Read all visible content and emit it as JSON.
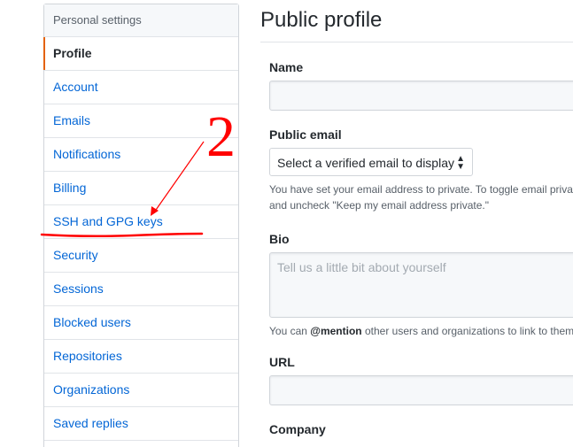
{
  "sidebar": {
    "header": "Personal settings",
    "items": [
      {
        "label": "Profile",
        "selected": true
      },
      {
        "label": "Account"
      },
      {
        "label": "Emails"
      },
      {
        "label": "Notifications"
      },
      {
        "label": "Billing"
      },
      {
        "label": "SSH and GPG keys"
      },
      {
        "label": "Security"
      },
      {
        "label": "Sessions"
      },
      {
        "label": "Blocked users"
      },
      {
        "label": "Repositories"
      },
      {
        "label": "Organizations"
      },
      {
        "label": "Saved replies"
      }
    ]
  },
  "main": {
    "title": "Public profile",
    "name_label": "Name",
    "public_email_label": "Public email",
    "public_email_select": "Select a verified email to display",
    "email_note_line1": "You have set your email address to private. To toggle email privac",
    "email_note_line2": "and uncheck \"Keep my email address private.\"",
    "bio_label": "Bio",
    "bio_placeholder": "Tell us a little bit about yourself",
    "bio_note_prefix": "You can ",
    "bio_note_mention": "@mention",
    "bio_note_suffix": " other users and organizations to link to them",
    "url_label": "URL",
    "company_label": "Company"
  },
  "annotation": {
    "number": "2",
    "color": "#ff0000"
  }
}
